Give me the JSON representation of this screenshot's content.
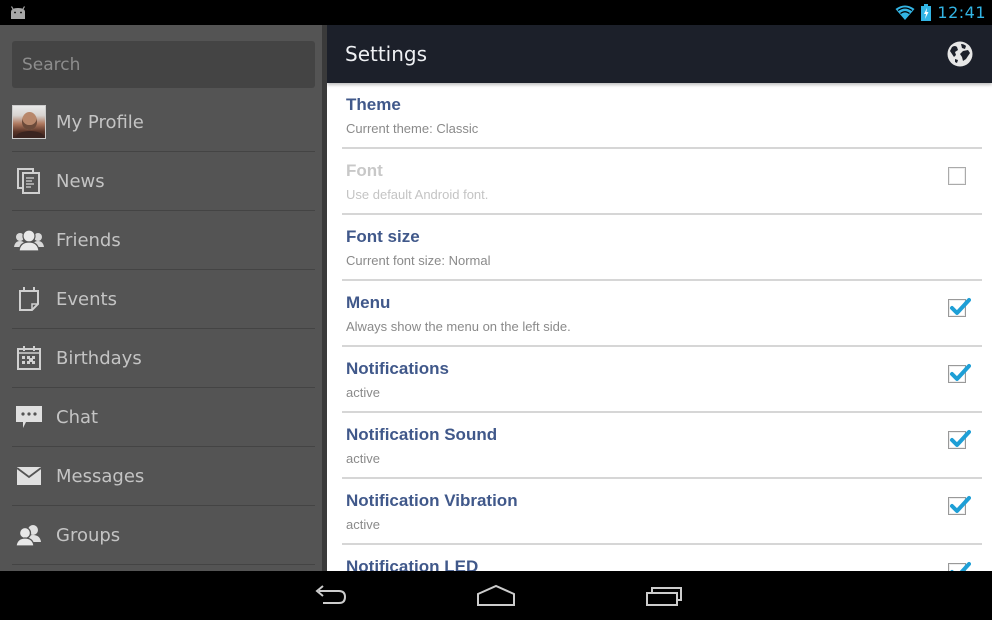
{
  "status_bar": {
    "time": "12:41",
    "icons": [
      "android-icon",
      "wifi-icon",
      "battery-charging-icon"
    ]
  },
  "sidebar": {
    "search": {
      "placeholder": "Search",
      "value": ""
    },
    "items": [
      {
        "label": "My Profile",
        "icon": "avatar"
      },
      {
        "label": "News",
        "icon": "news-icon"
      },
      {
        "label": "Friends",
        "icon": "friends-icon"
      },
      {
        "label": "Events",
        "icon": "events-icon"
      },
      {
        "label": "Birthdays",
        "icon": "birthdays-icon"
      },
      {
        "label": "Chat",
        "icon": "chat-icon"
      },
      {
        "label": "Messages",
        "icon": "messages-icon"
      },
      {
        "label": "Groups",
        "icon": "groups-icon"
      }
    ]
  },
  "header": {
    "title": "Settings",
    "action_icon": "globe-icon"
  },
  "settings": [
    {
      "title": "Theme",
      "summary": "Current theme: Classic",
      "checkbox": null,
      "enabled": true
    },
    {
      "title": "Font",
      "summary": "Use default Android font.",
      "checkbox": false,
      "enabled": false
    },
    {
      "title": "Font size",
      "summary": "Current font size: Normal",
      "checkbox": null,
      "enabled": true
    },
    {
      "title": "Menu",
      "summary": "Always show the menu on the left side.",
      "checkbox": true,
      "enabled": true
    },
    {
      "title": "Notifications",
      "summary": "active",
      "checkbox": true,
      "enabled": true
    },
    {
      "title": "Notification Sound",
      "summary": "active",
      "checkbox": true,
      "enabled": true
    },
    {
      "title": "Notification Vibration",
      "summary": "active",
      "checkbox": true,
      "enabled": true
    },
    {
      "title": "Notification LED",
      "summary": "",
      "checkbox": true,
      "enabled": true
    }
  ],
  "navigation_bar": {
    "buttons": [
      "back",
      "home",
      "recent-apps"
    ]
  },
  "colors": {
    "accent": "#33b5e5",
    "pref_title": "#40588a",
    "action_bar": "#1c202a",
    "sidebar": "#545454"
  }
}
